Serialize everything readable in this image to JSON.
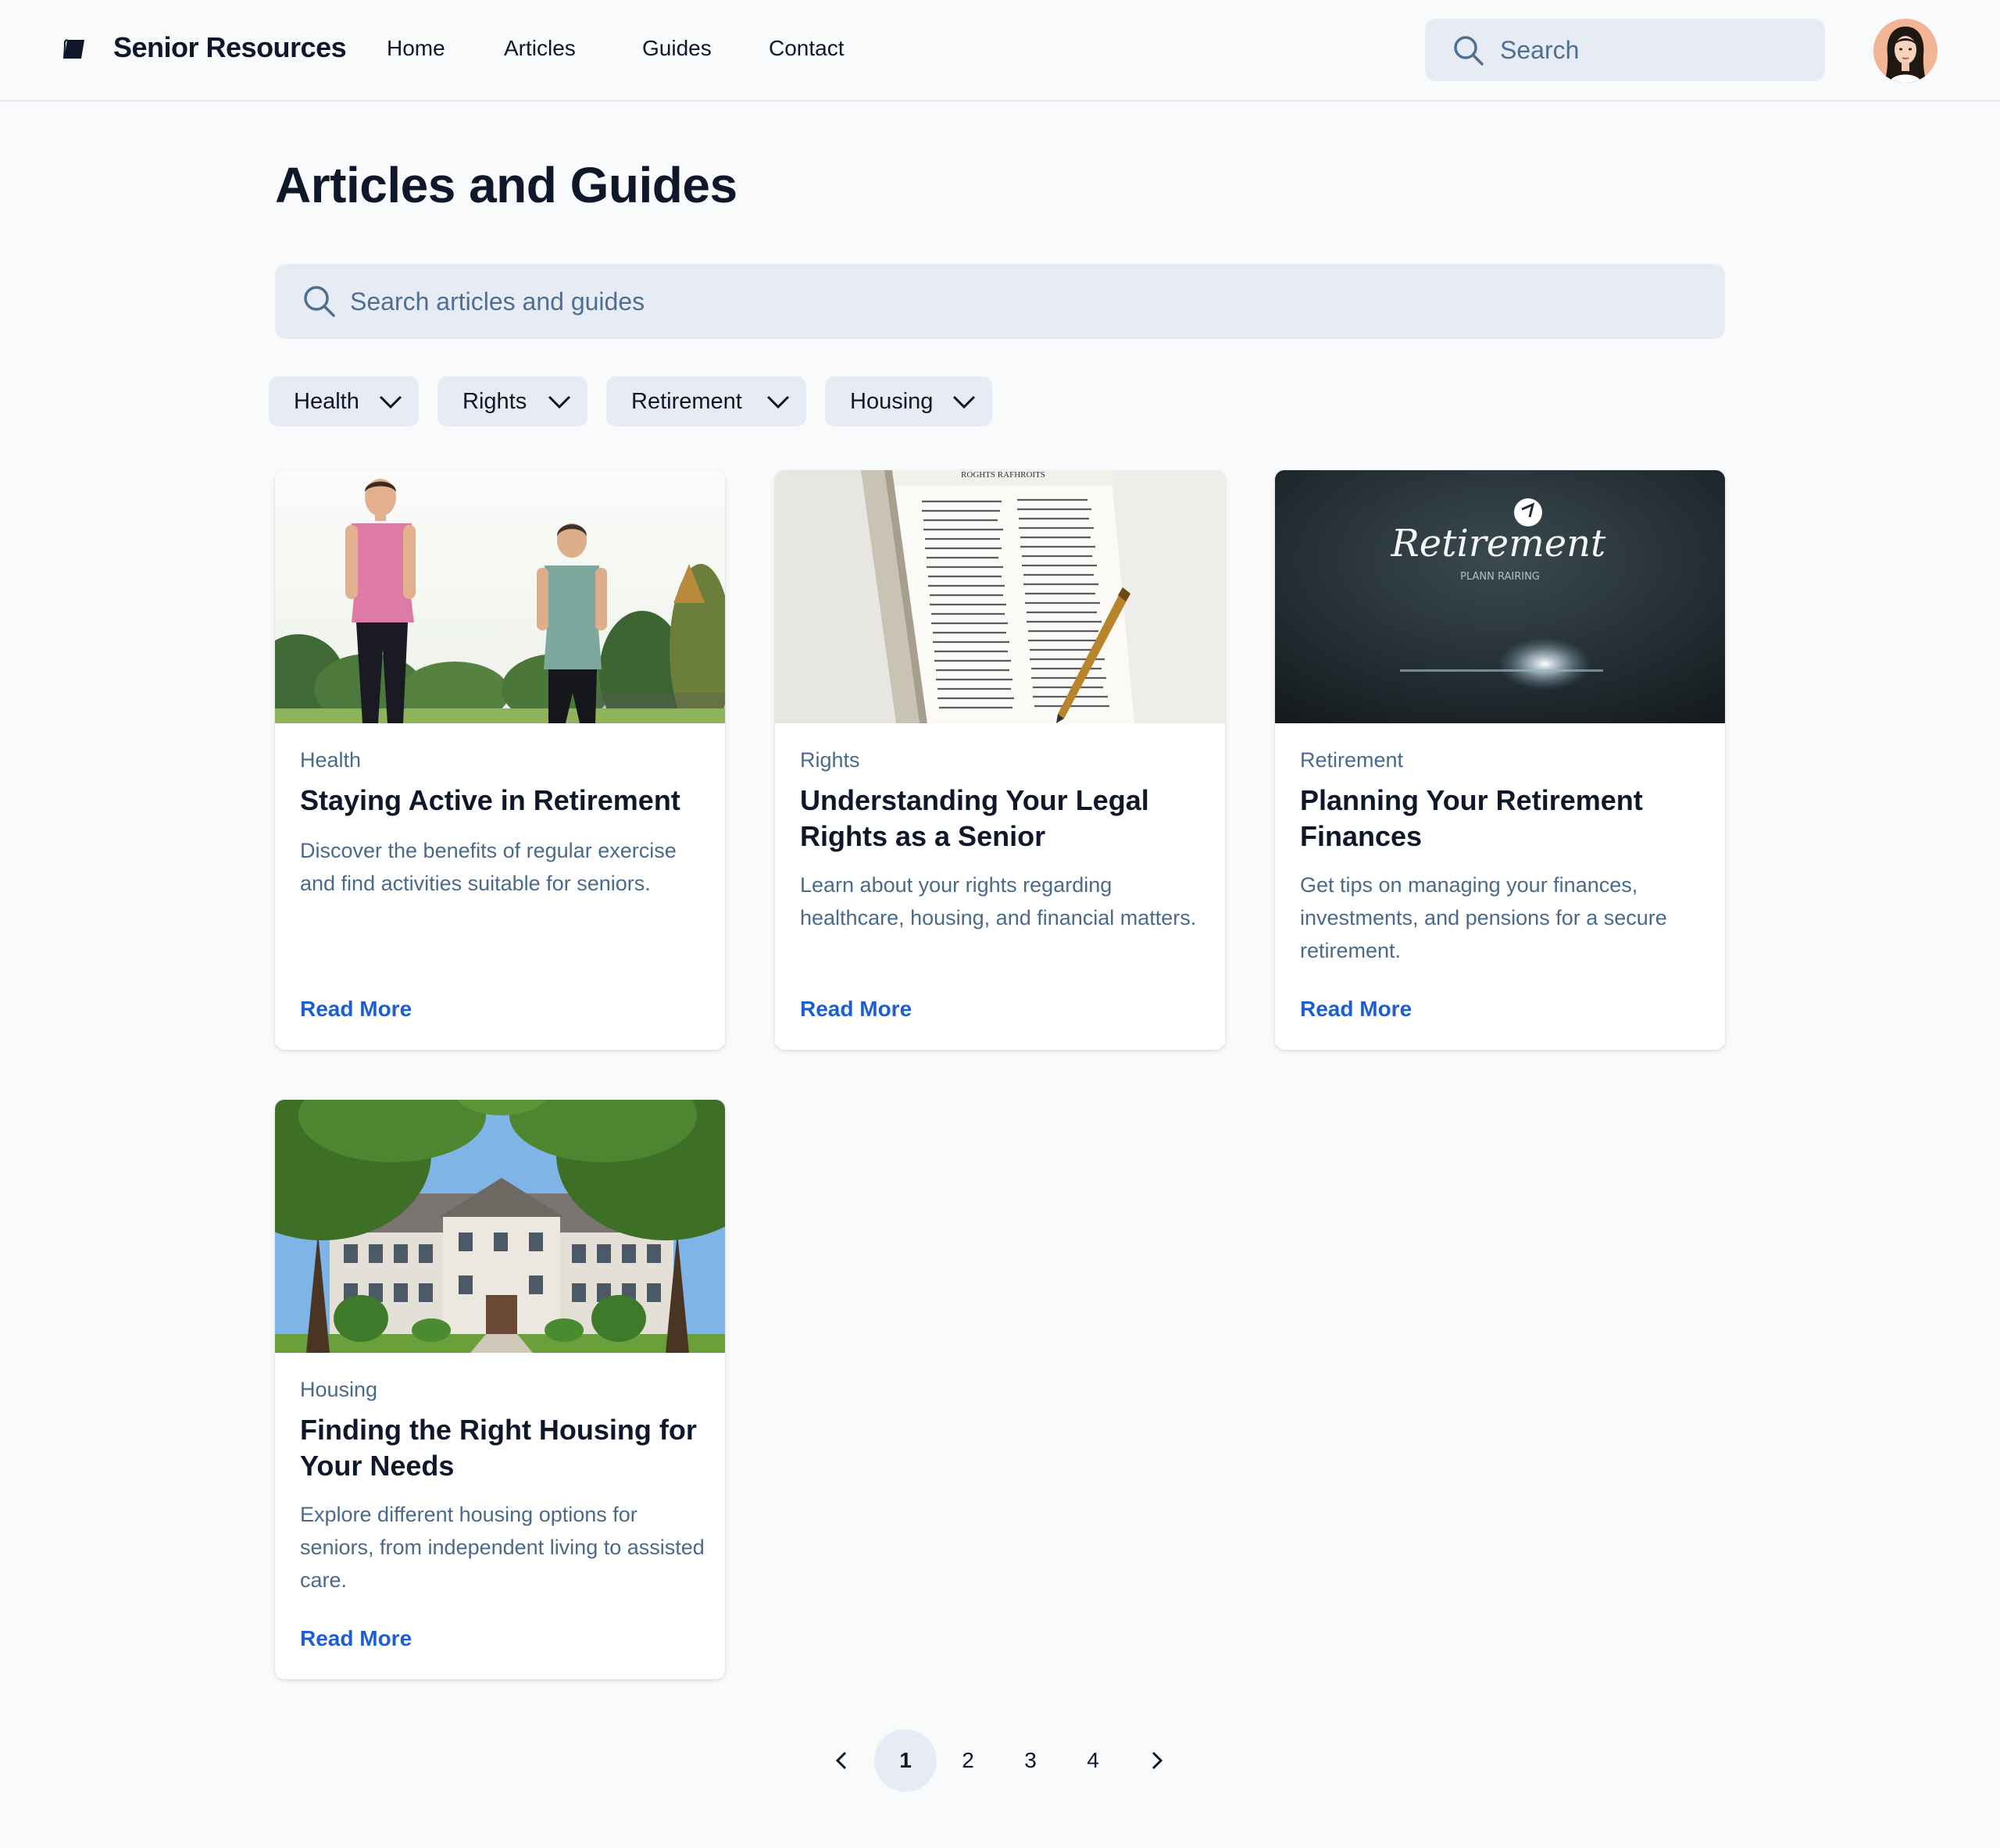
{
  "header": {
    "brand": "Senior Resources",
    "nav": [
      {
        "label": "Home"
      },
      {
        "label": "Articles"
      },
      {
        "label": "Guides"
      },
      {
        "label": "Contact"
      }
    ],
    "search_placeholder": "Search"
  },
  "main": {
    "title": "Articles and Guides",
    "search_placeholder": "Search articles and guides",
    "filters": [
      {
        "label": "Health"
      },
      {
        "label": "Rights"
      },
      {
        "label": "Retirement"
      },
      {
        "label": "Housing"
      }
    ],
    "cards": [
      {
        "category": "Health",
        "title": "Staying Active in Retirement",
        "description": "Discover the benefits of regular exercise and find activities suitable for seniors.",
        "link": "Read More"
      },
      {
        "category": "Rights",
        "title": "Understanding Your Legal Rights as a Senior",
        "description": "Learn about your rights regarding healthcare, housing, and financial matters.",
        "link": "Read More",
        "image_text": "ROGHTS RAFHROITS"
      },
      {
        "category": "Retirement",
        "title": "Planning Your Retirement Finances",
        "description": "Get tips on managing your finances, investments, and pensions for a secure retirement.",
        "link": "Read More",
        "image_text": "Retirement",
        "image_subtext": "PLANN RAIRING"
      },
      {
        "category": "Housing",
        "title": "Finding the Right Housing for Your Needs",
        "description": "Explore different housing options for seniors, from independent living to assisted care.",
        "link": "Read More"
      }
    ]
  },
  "pagination": {
    "pages": [
      "1",
      "2",
      "3",
      "4"
    ],
    "current": "1"
  },
  "colors": {
    "background": "#f8fafc",
    "input_bg": "#e7ecf4",
    "muted_text": "#4a6a8c",
    "link": "#1d5fd1",
    "heading": "#0f172a"
  },
  "icons": [
    "book-logo-icon",
    "search-icon",
    "chevron-down-icon",
    "chevron-left-icon",
    "chevron-right-icon"
  ]
}
